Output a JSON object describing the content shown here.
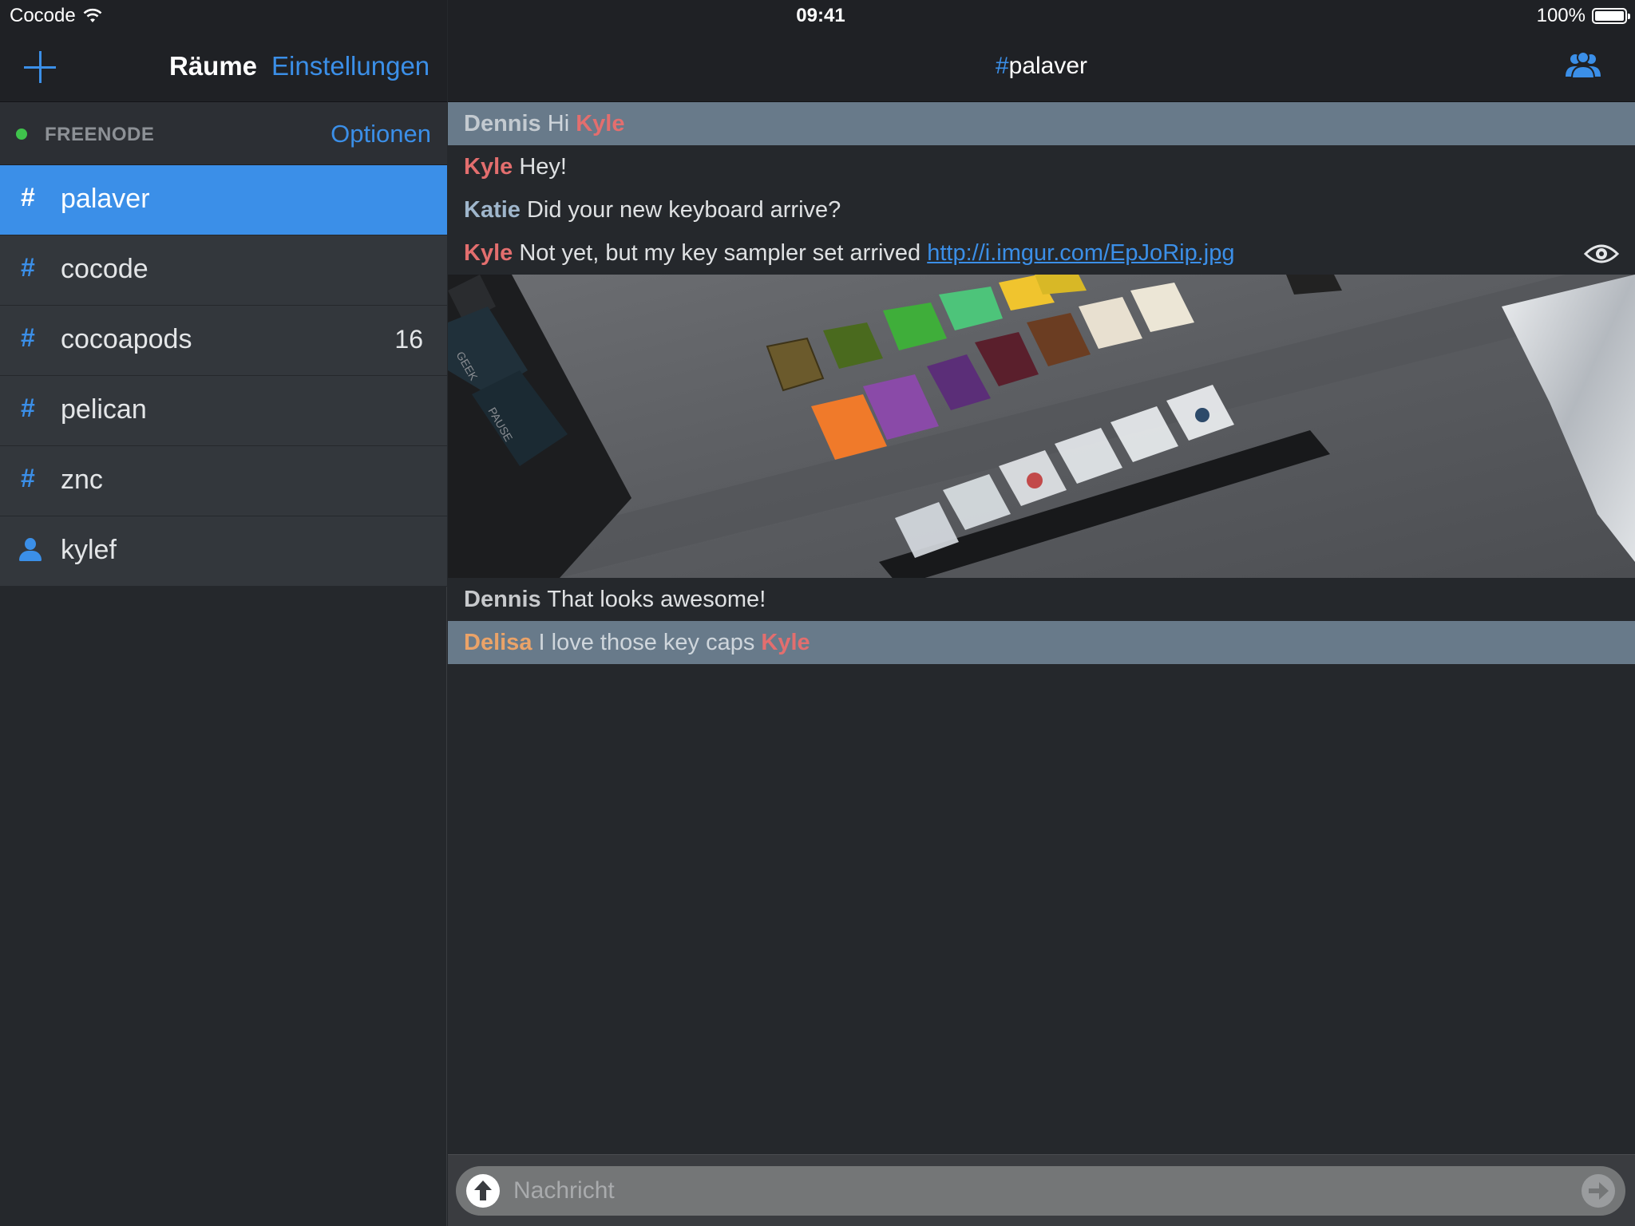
{
  "status_bar": {
    "carrier": "Cocode",
    "time": "09:41",
    "battery": "100%"
  },
  "sidebar": {
    "nav_title": "Räume",
    "settings_label": "Einstellungen",
    "server": {
      "name": "FREENODE",
      "options_label": "Optionen",
      "status_color": "#3fc34c"
    },
    "rooms": [
      {
        "icon": "hash",
        "name": "palaver",
        "badge": "",
        "active": true
      },
      {
        "icon": "hash",
        "name": "cocode",
        "badge": ""
      },
      {
        "icon": "hash",
        "name": "cocoapods",
        "badge": "16"
      },
      {
        "icon": "hash",
        "name": "pelican",
        "badge": ""
      },
      {
        "icon": "hash",
        "name": "znc",
        "badge": ""
      },
      {
        "icon": "person",
        "name": "kylef",
        "badge": ""
      }
    ]
  },
  "chat": {
    "title_hash": "#",
    "title_name": "palaver",
    "messages": [
      {
        "nick": "Dennis",
        "text": "Hi",
        "mention": "Kyle",
        "highlighted": true
      },
      {
        "nick": "Kyle",
        "text": "Hey!"
      },
      {
        "nick": "Katie",
        "text": "Did your new keyboard arrive?"
      },
      {
        "nick": "Kyle",
        "text": "Not yet, but my key sampler set arrived",
        "link": "http://i.imgur.com/EpJoRip.jpg"
      },
      {
        "nick": "Dennis",
        "text": "That looks awesome!"
      },
      {
        "nick": "Delisa",
        "text": "I love those key caps",
        "mention": "Kyle",
        "highlighted": true
      }
    ],
    "input_placeholder": "Nachricht"
  },
  "colors": {
    "accent": "#3b8fe8",
    "highlight_row": "#687a8a",
    "nick_kyle": "#e36e6e",
    "nick_katie": "#9fb6cc",
    "nick_delisa": "#eba368"
  }
}
